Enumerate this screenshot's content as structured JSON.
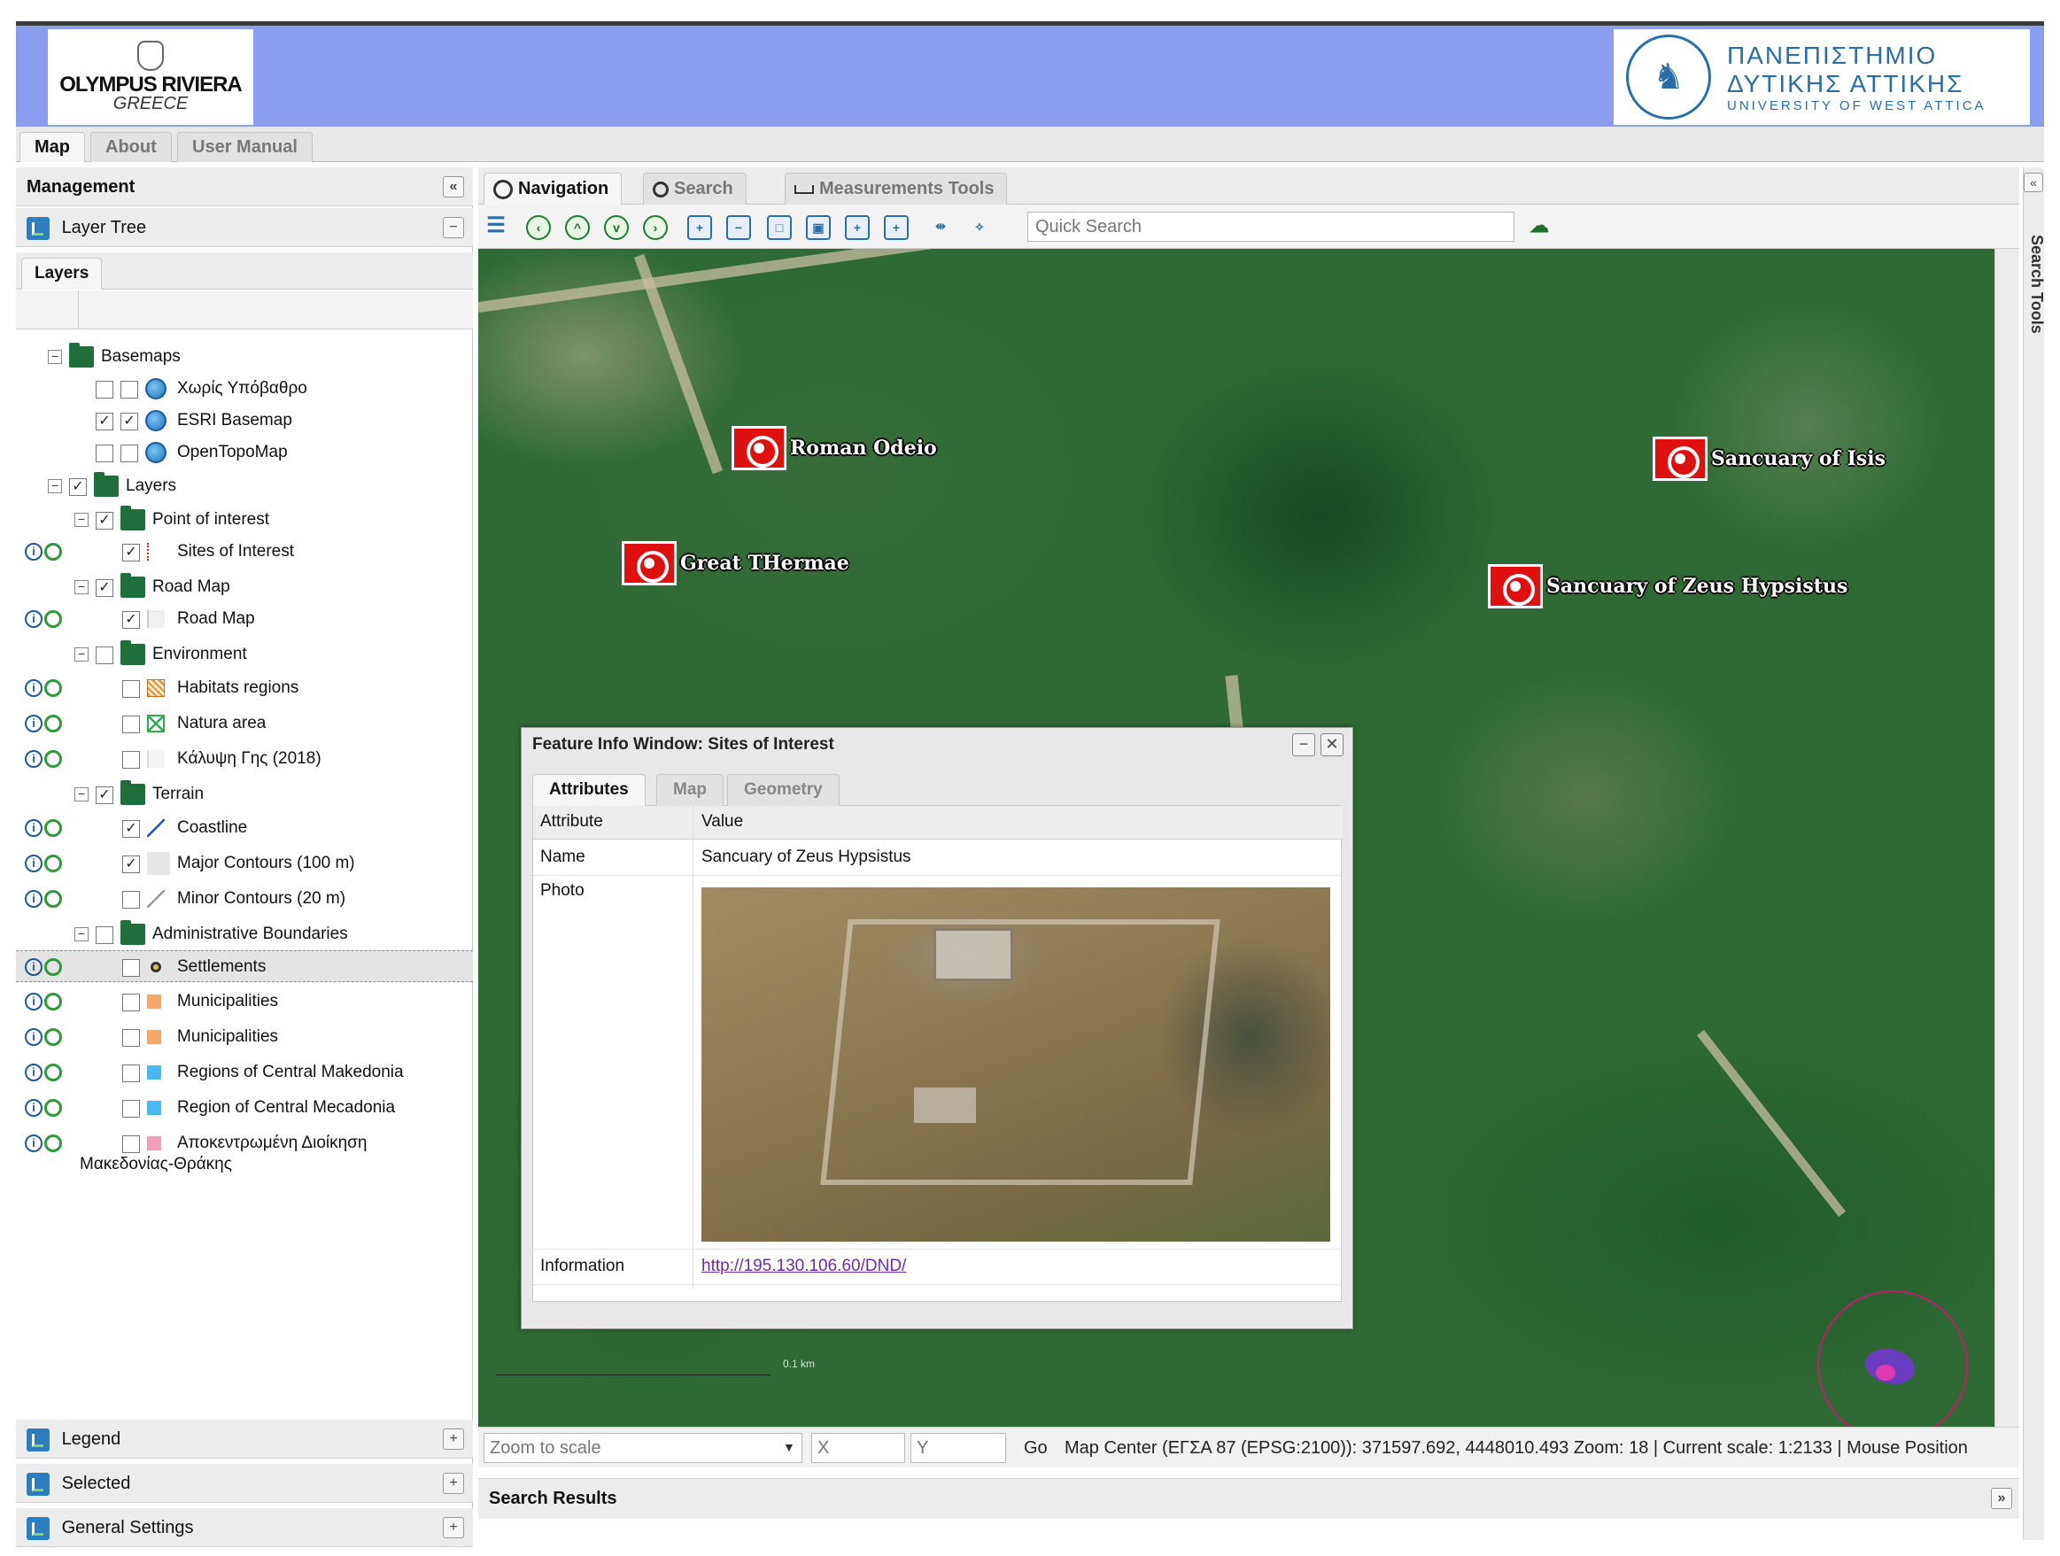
{
  "header": {
    "left_logo_line1": "OLYMPUS RIVIERA",
    "left_logo_line2": "GREECE",
    "right_logo_line1": "ΠΑΝΕΠΙΣΤΗΜΙΟ",
    "right_logo_line2": "ΔΥΤΙΚΗΣ ΑΤΤΙΚΗΣ",
    "right_logo_line3": "UNIVERSITY OF WEST ATTICA"
  },
  "main_tabs": [
    {
      "label": "Map",
      "active": true
    },
    {
      "label": "About",
      "active": false
    },
    {
      "label": "User Manual",
      "active": false
    }
  ],
  "left_panel": {
    "title": "Management",
    "layer_tree_title": "Layer Tree",
    "layers_tab": "Layers",
    "tree": [
      {
        "label": "Basemaps",
        "type": "folder",
        "expanded": true,
        "checked": null
      },
      {
        "label": "Χωρίς Υπόβαθρο",
        "type": "basemap",
        "checked": false
      },
      {
        "label": "ESRI Basemap",
        "type": "basemap",
        "checked": true
      },
      {
        "label": "OpenTopoMap",
        "type": "basemap",
        "checked": false
      },
      {
        "label": "Layers",
        "type": "folder",
        "expanded": true,
        "checked": true
      },
      {
        "label": "Point of interest",
        "type": "folder",
        "expanded": true,
        "checked": true
      },
      {
        "label": "Sites of Interest",
        "type": "layer",
        "checked": true,
        "icon": "pin-icon"
      },
      {
        "label": "Road Map",
        "type": "folder",
        "expanded": true,
        "checked": true
      },
      {
        "label": "Road Map",
        "type": "layer",
        "checked": true,
        "icon": "line-icon"
      },
      {
        "label": "Environment",
        "type": "folder",
        "expanded": true,
        "checked": false
      },
      {
        "label": "Habitats regions",
        "type": "layer",
        "checked": false,
        "icon": "hatch-icon"
      },
      {
        "label": "Natura area",
        "type": "layer",
        "checked": false,
        "icon": "cross-box-icon"
      },
      {
        "label": "Κάλυψη Γης (2018)",
        "type": "layer",
        "checked": false,
        "icon": "landcover-icon"
      },
      {
        "label": "Terrain",
        "type": "folder",
        "expanded": true,
        "checked": true
      },
      {
        "label": "Coastline",
        "type": "layer",
        "checked": true,
        "icon": "coastline-icon"
      },
      {
        "label": "Major Contours (100 m)",
        "type": "layer",
        "checked": true,
        "icon": "contour-icon"
      },
      {
        "label": "Minor Contours (20 m)",
        "type": "layer",
        "checked": false,
        "icon": "minor-contour-icon"
      },
      {
        "label": "Administrative Boundaries",
        "type": "folder",
        "expanded": true,
        "checked": false
      },
      {
        "label": "Settlements",
        "type": "layer",
        "checked": false,
        "icon": "dot-icon",
        "selected": true
      },
      {
        "label": "Municipalities",
        "type": "layer",
        "checked": false,
        "icon": "orange-square-icon"
      },
      {
        "label": "Municipalities",
        "type": "layer",
        "checked": false,
        "icon": "orange-square-icon"
      },
      {
        "label": "Regions of Central Makedonia",
        "type": "layer",
        "checked": false,
        "icon": "blue-square-icon"
      },
      {
        "label": "Region of Central Mecadonia",
        "type": "layer",
        "checked": false,
        "icon": "blue-square-icon"
      },
      {
        "label": "Αποκεντρωμένη Διοίκηση",
        "label2": "Μακεδονίας-Θράκης",
        "type": "layer",
        "checked": false,
        "icon": "pink-square-icon"
      }
    ],
    "collapsed_panels": [
      "Legend",
      "Selected",
      "General Settings"
    ]
  },
  "right_tabs": [
    {
      "label": "Navigation",
      "active": true
    },
    {
      "label": "Search",
      "active": false
    },
    {
      "label": "Measurements Tools",
      "active": false
    }
  ],
  "toolbar": {
    "quick_search_placeholder": "Quick Search"
  },
  "map": {
    "pois": [
      {
        "label": "Roman Odeio"
      },
      {
        "label": "Sancuary of Isis"
      },
      {
        "label": "Great THermae"
      },
      {
        "label": "Sancuary of Zeus Hypsistus"
      }
    ],
    "scale_label": "0.1 km"
  },
  "feature_window": {
    "title": "Feature Info Window: Sites of Interest",
    "tabs": [
      {
        "label": "Attributes",
        "active": true
      },
      {
        "label": "Map",
        "active": false
      },
      {
        "label": "Geometry",
        "active": false
      }
    ],
    "columns": [
      "Attribute",
      "Value"
    ],
    "rows": {
      "name_attr": "Name",
      "name_val": "Sancuary of Zeus Hypsistus",
      "photo_attr": "Photo",
      "info_attr": "Information",
      "info_val": "http://195.130.106.60/DND/"
    }
  },
  "status": {
    "zoom_placeholder": "Zoom to scale",
    "x_placeholder": "X",
    "y_placeholder": "Y",
    "go": "Go",
    "text": "Map Center (ΕΓΣΑ 87 (EPSG:2100)): 371597.692, 4448010.493 Zoom: 18 | Current scale: 1:2133 | Mouse Position"
  },
  "search_results": "Search Results",
  "search_tools": "Search Tools"
}
